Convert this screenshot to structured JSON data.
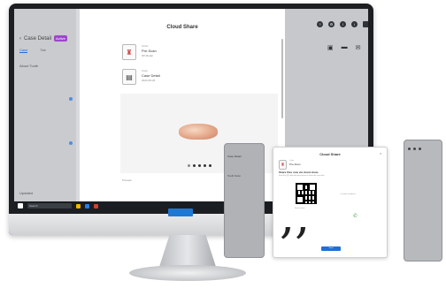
{
  "monitor": {
    "left_pane": {
      "title": "Case Detail",
      "badge": "Active",
      "tabs": [
        "Case",
        "Tab"
      ],
      "sub": "About Tooth",
      "footer": "Updated"
    },
    "dialog": {
      "title": "Cloud Share",
      "files": [
        {
          "icon": "tooth-file-icon",
          "label": "Order",
          "value": "Pre-Scan",
          "sub": "3D Model"
        },
        {
          "icon": "case-file-icon",
          "label": "Case",
          "value": "Case Detail",
          "sub": "2023-09-26"
        }
      ],
      "caption": "Preview"
    },
    "right_toolbar": [
      "?",
      "⚙",
      "!",
      "i"
    ],
    "actions": [
      "▣",
      "▬",
      "✉",
      "⇪"
    ],
    "taskbar": {
      "search": "Search"
    }
  },
  "phone1": {
    "title": "Case Detail",
    "sub": "Tooth Scan"
  },
  "tablet": {
    "title": "Cloud Share",
    "close": "×",
    "file_label": "Order",
    "file_value": "Pre-Scan",
    "heading": "Share files now via cloud share",
    "desc": "Scan the QR code with your phone to share the scan data",
    "right_note": "or share via device",
    "note": "Scan to view",
    "button": "Send"
  },
  "colors": {
    "accent": "#1e6fd8",
    "badge": "#9d47c9",
    "monitor_frame": "#1d1f22"
  }
}
